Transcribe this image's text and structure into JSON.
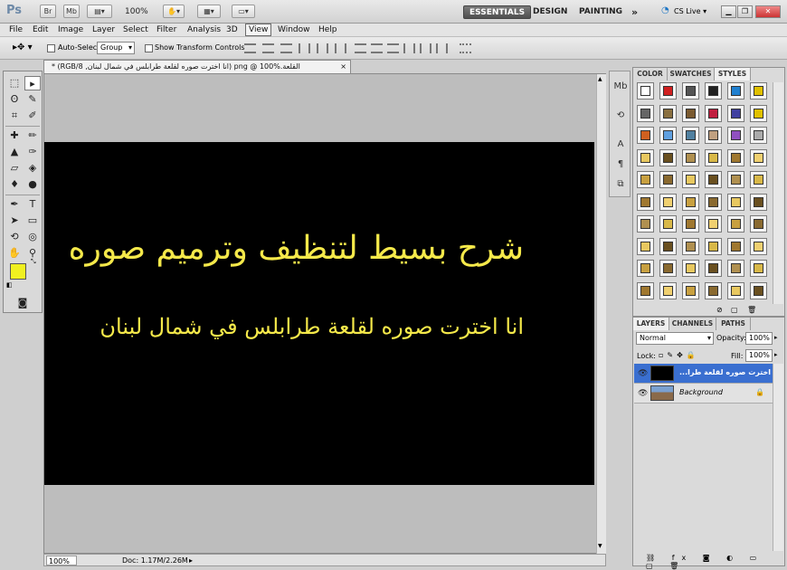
{
  "app": {
    "logo": "Ps",
    "bridge_label": "Br",
    "minibridge_label": "Mb",
    "zoom_level": "100%",
    "workspaces": [
      "ESSENTIALS",
      "DESIGN",
      "PAINTING"
    ],
    "more": "»",
    "cs_live": "CS Live"
  },
  "menu": [
    "File",
    "Edit",
    "Image",
    "Layer",
    "Select",
    "Filter",
    "Analysis",
    "3D",
    "View",
    "Window",
    "Help"
  ],
  "options": {
    "auto_select_label": "Auto-Select:",
    "auto_select_value": "Group",
    "transform_label": "Show Transform Controls"
  },
  "document": {
    "tab_title": "القلعة.png @ 100% (انا اخترت صوره لقلعة طرابلس في شمال لبنان, RGB/8) *",
    "headline": "شرح بسيط لتنظيف وترميم صوره",
    "subline": "انا اخترت صوره لقلعة طرابلس في شمال لبنان",
    "status_zoom": "100%",
    "status_doc": "Doc: 1.17M/2.26M"
  },
  "colors": {
    "foreground": "#f0f020",
    "background": "#ffffff",
    "text_yellow": "#f5e94a",
    "layer_selected": "#3a6fd0"
  },
  "styles_panel": {
    "tabs": [
      "COLOR",
      "SWATCHES",
      "STYLES"
    ]
  },
  "layers_panel": {
    "tabs": [
      "LAYERS",
      "CHANNELS",
      "PATHS"
    ],
    "blend_mode": "Normal",
    "opacity_label": "Opacity:",
    "opacity_value": "100%",
    "lock_label": "Lock:",
    "fill_label": "Fill:",
    "fill_value": "100%",
    "layers": [
      {
        "name": "انا اخترت صوره لقلعة طرا...",
        "selected": true
      },
      {
        "name": "Background",
        "selected": false
      }
    ]
  }
}
